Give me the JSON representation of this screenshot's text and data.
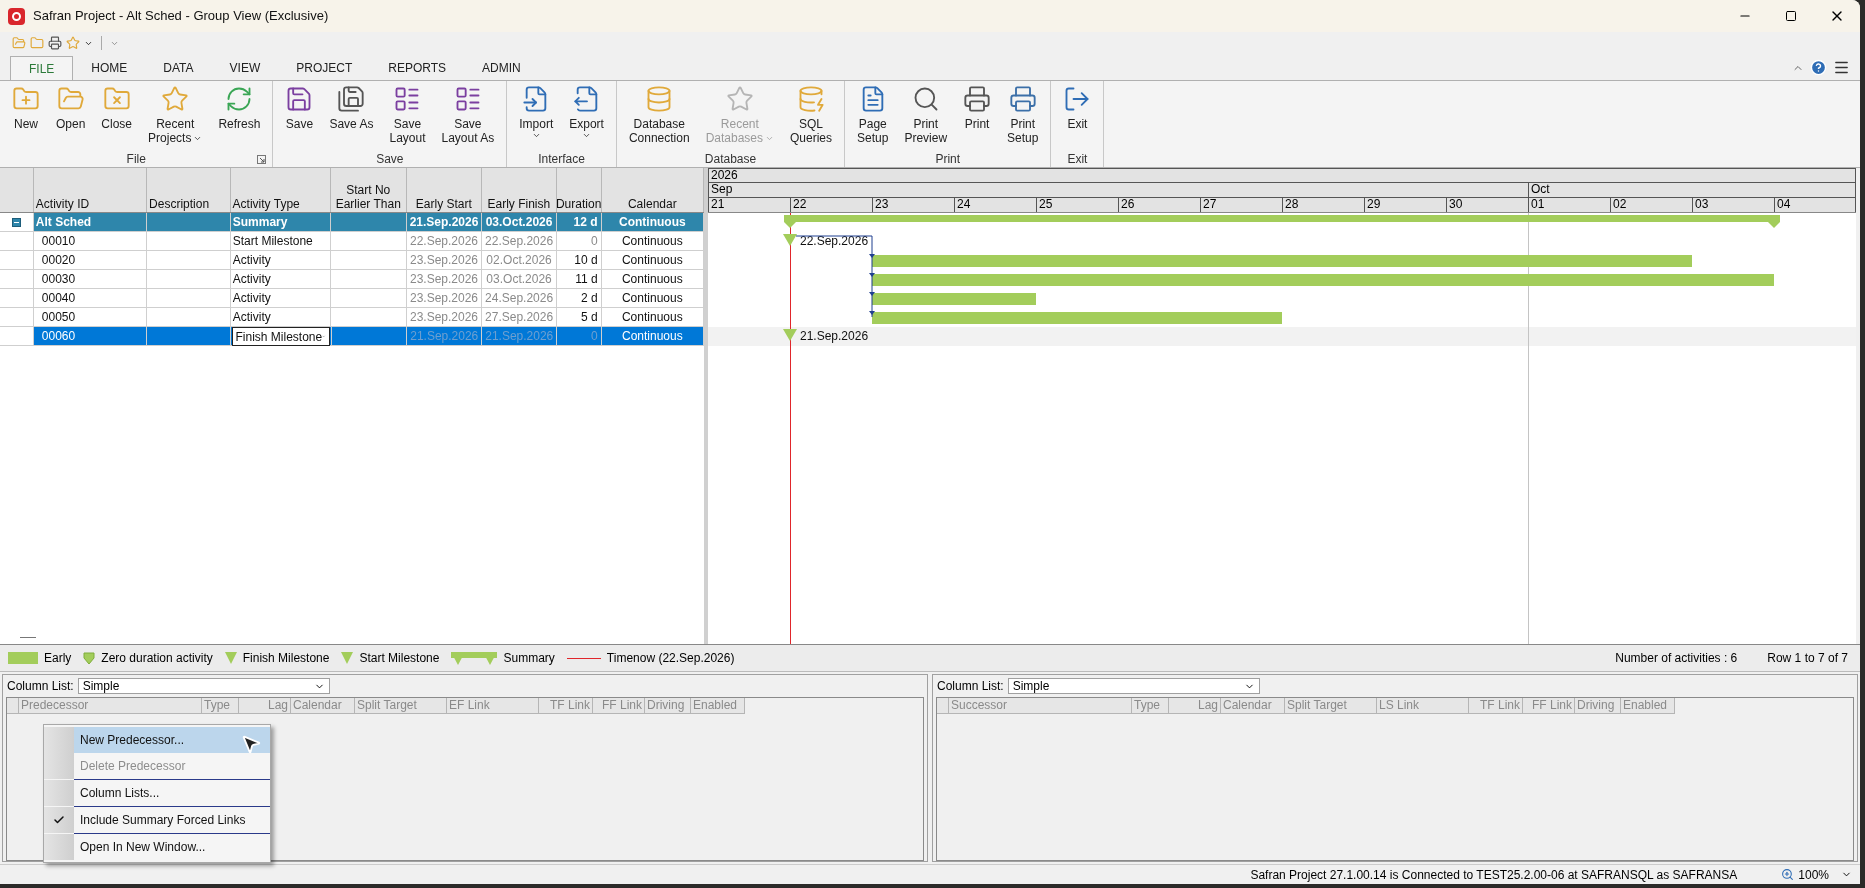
{
  "window": {
    "title": "Safran Project - Alt Sched - Group View (Exclusive)"
  },
  "ribbon": {
    "tabs": [
      {
        "label": "FILE",
        "selected": true
      },
      {
        "label": "HOME",
        "selected": false
      },
      {
        "label": "DATA",
        "selected": false
      },
      {
        "label": "VIEW",
        "selected": false
      },
      {
        "label": "PROJECT",
        "selected": false
      },
      {
        "label": "REPORTS",
        "selected": false
      },
      {
        "label": "ADMIN",
        "selected": false
      }
    ],
    "groups": [
      {
        "label": "File",
        "launcher": true,
        "buttons": [
          {
            "label": "New",
            "kind": "new",
            "dropdown": false,
            "disabled": false
          },
          {
            "label": "Open",
            "kind": "open",
            "dropdown": false,
            "disabled": false
          },
          {
            "label": "Close",
            "kind": "close",
            "dropdown": false,
            "disabled": false
          },
          {
            "label": "Recent\nProjects",
            "kind": "recent",
            "dropdown": true,
            "disabled": false
          },
          {
            "label": "Refresh",
            "kind": "refresh",
            "dropdown": false,
            "disabled": false
          }
        ]
      },
      {
        "label": "Save",
        "launcher": false,
        "buttons": [
          {
            "label": "Save",
            "kind": "save",
            "dropdown": false,
            "disabled": false
          },
          {
            "label": "Save As",
            "kind": "save_as",
            "dropdown": false,
            "disabled": false
          },
          {
            "label": "Save\nLayout",
            "kind": "layout",
            "dropdown": false,
            "disabled": false
          },
          {
            "label": "Save\nLayout As",
            "kind": "layout",
            "dropdown": false,
            "disabled": false
          }
        ]
      },
      {
        "label": "Interface",
        "launcher": false,
        "buttons": [
          {
            "label": "Import",
            "kind": "import",
            "dropdown": true,
            "disabled": false
          },
          {
            "label": "Export",
            "kind": "export",
            "dropdown": true,
            "disabled": false
          }
        ]
      },
      {
        "label": "Database",
        "launcher": false,
        "buttons": [
          {
            "label": "Database\nConnection",
            "kind": "database",
            "dropdown": false,
            "disabled": false
          },
          {
            "label": "Recent\nDatabases",
            "kind": "recent_db",
            "dropdown": true,
            "disabled": true
          },
          {
            "label": "SQL\nQueries",
            "kind": "sql",
            "dropdown": false,
            "disabled": false
          }
        ]
      },
      {
        "label": "Print",
        "launcher": false,
        "buttons": [
          {
            "label": "Page\nSetup",
            "kind": "page",
            "dropdown": false,
            "disabled": false
          },
          {
            "label": "Print\nPreview",
            "kind": "preview",
            "dropdown": false,
            "disabled": false
          },
          {
            "label": "Print",
            "kind": "print",
            "dropdown": false,
            "disabled": false
          },
          {
            "label": "Print\nSetup",
            "kind": "print_setup",
            "dropdown": false,
            "disabled": false
          }
        ]
      },
      {
        "label": "Exit",
        "launcher": false,
        "buttons": [
          {
            "label": "Exit",
            "kind": "exit",
            "dropdown": false,
            "disabled": false
          }
        ]
      }
    ]
  },
  "table": {
    "columns": [
      "Activity ID",
      "Description",
      "Activity Type",
      "Start No Earlier Than",
      "Early Start",
      "Early Finish",
      "Duration",
      "Calendar"
    ],
    "rows": [
      {
        "kind": "summary",
        "id": "Alt Sched",
        "type": "Summary",
        "early_start": "21.Sep.2026",
        "early_finish": "03.Oct.2026",
        "duration": "12 d",
        "calendar": "Continuous",
        "selected": false,
        "expanded": true,
        "children": [
          {
            "kind": "start_milestone",
            "id": "00010",
            "type": "Start Milestone",
            "early_start": "22.Sep.2026",
            "early_finish": "22.Sep.2026",
            "duration": "0",
            "calendar": "Continuous",
            "selected": false,
            "gantt_label": "22.Sep.2026"
          },
          {
            "kind": "activity",
            "id": "00020",
            "type": "Activity",
            "early_start": "23.Sep.2026",
            "early_finish": "02.Oct.2026",
            "duration": "10 d",
            "calendar": "Continuous",
            "selected": false
          },
          {
            "kind": "activity",
            "id": "00030",
            "type": "Activity",
            "early_start": "23.Sep.2026",
            "early_finish": "03.Oct.2026",
            "duration": "11 d",
            "calendar": "Continuous",
            "selected": false
          },
          {
            "kind": "activity",
            "id": "00040",
            "type": "Activity",
            "early_start": "23.Sep.2026",
            "early_finish": "24.Sep.2026",
            "duration": "2 d",
            "calendar": "Continuous",
            "selected": false
          },
          {
            "kind": "activity",
            "id": "00050",
            "type": "Activity",
            "early_start": "23.Sep.2026",
            "early_finish": "27.Sep.2026",
            "duration": "5 d",
            "calendar": "Continuous",
            "selected": false
          },
          {
            "kind": "finish_milestone",
            "id": "00060",
            "type": "Finish Milestone",
            "early_start": "21.Sep.2026",
            "early_finish": "21.Sep.2026",
            "duration": "0",
            "calendar": "Continuous",
            "selected": true,
            "gantt_label": "21.Sep.2026"
          }
        ]
      }
    ]
  },
  "gantt": {
    "year": "2026",
    "months": [
      "Sep",
      "Oct"
    ],
    "days": [
      "21",
      "22",
      "23",
      "24",
      "25",
      "26",
      "27",
      "28",
      "29",
      "30",
      "01",
      "02",
      "03",
      "04"
    ]
  },
  "legend": {
    "items": [
      {
        "kind": "early",
        "label": "Early"
      },
      {
        "kind": "zero",
        "label": "Zero duration activity"
      },
      {
        "kind": "finish",
        "label": "Finish Milestone"
      },
      {
        "kind": "start",
        "label": "Start Milestone"
      },
      {
        "kind": "summary",
        "label": "Summary"
      },
      {
        "kind": "timenow",
        "label": "Timenow (22.Sep.2026)"
      }
    ],
    "count": "Number of activities : 6",
    "rows": "Row 1 to 7 of 7"
  },
  "predecessors": {
    "column_list_label": "Column List:",
    "column_list": "Simple",
    "columns": [
      "Predecessor",
      "Type",
      "Lag",
      "Calendar",
      "Split Target",
      "EF Link",
      "TF Link",
      "FF Link",
      "Driving",
      "Enabled"
    ]
  },
  "successors": {
    "column_list_label": "Column List:",
    "column_list": "Simple",
    "columns": [
      "Successor",
      "Type",
      "Lag",
      "Calendar",
      "Split Target",
      "LS Link",
      "TF Link",
      "FF Link",
      "Driving",
      "Enabled"
    ]
  },
  "context_menu": {
    "groups": [
      [
        {
          "label": "New Predecessor...",
          "selected": true,
          "disabled": false,
          "checked": false
        },
        {
          "label": "Delete Predecessor",
          "selected": false,
          "disabled": true,
          "checked": false
        }
      ],
      [
        {
          "label": "Column Lists...",
          "selected": false,
          "disabled": false,
          "checked": false
        }
      ],
      [
        {
          "label": "Include Summary Forced Links",
          "selected": false,
          "disabled": false,
          "checked": true
        }
      ],
      [
        {
          "label": "Open In New Window...",
          "selected": false,
          "disabled": false,
          "checked": false
        }
      ]
    ]
  },
  "status_bar": {
    "text": "Safran Project 27.1.00.14 is Connected to TEST25.2.00-06 at SAFRANSQL as SAFRANSA",
    "zoom": "100%"
  }
}
